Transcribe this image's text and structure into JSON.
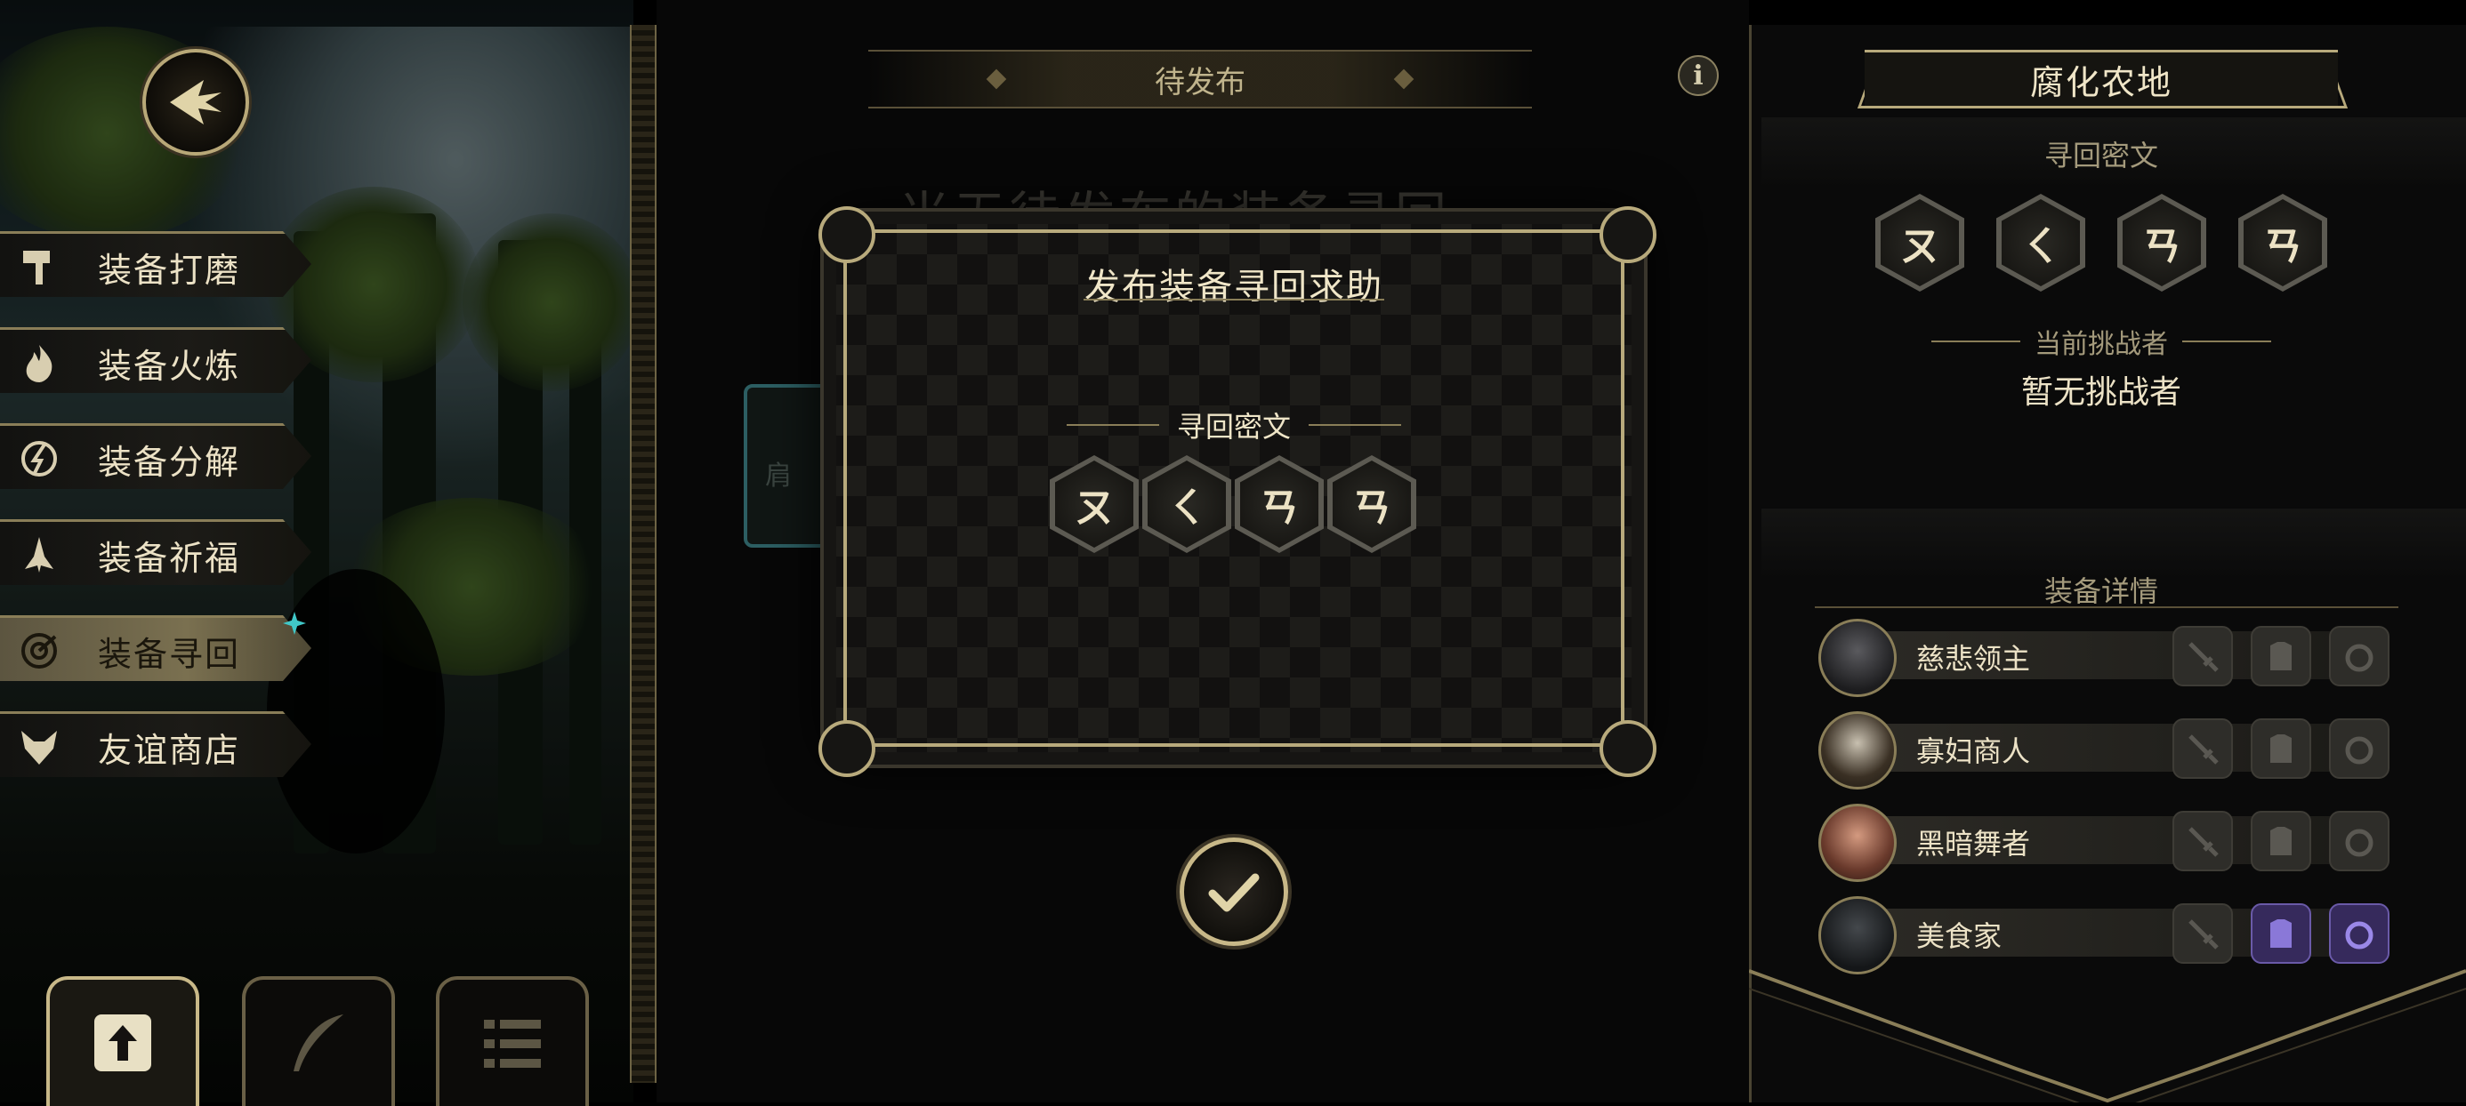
{
  "left_menu": {
    "items": [
      {
        "label": "装备打磨",
        "icon": "hammer-icon"
      },
      {
        "label": "装备火炼",
        "icon": "flame-icon"
      },
      {
        "label": "装备分解",
        "icon": "decompose-icon"
      },
      {
        "label": "装备祈福",
        "icon": "pray-hands-icon"
      },
      {
        "label": "装备寻回",
        "icon": "target-icon",
        "active": true
      },
      {
        "label": "友谊商店",
        "icon": "fox-icon"
      }
    ]
  },
  "bottom_tabs": [
    {
      "icon": "upload-document-icon",
      "selected": true
    },
    {
      "icon": "feather-icon"
    },
    {
      "icon": "list-icon"
    }
  ],
  "center": {
    "header": "待发布",
    "background_title": "当无待发布的装备寻回",
    "background_card_text": "肩"
  },
  "dialog": {
    "title": "发布装备寻回求助",
    "section_label": "寻回密文",
    "runes": [
      "ㄡ",
      "ㄑ",
      "ㄢ",
      "ㄢ"
    ]
  },
  "right_panel": {
    "location_title": "腐化农地",
    "cipher_label": "寻回密文",
    "runes": [
      "ㄡ",
      "ㄑ",
      "ㄢ",
      "ㄢ"
    ],
    "challenger_label": "当前挑战者",
    "challenger_value": "暂无挑战者",
    "equipment_label": "装备详情",
    "characters": [
      {
        "name": "慈悲领主",
        "slots": [
          false,
          false,
          false
        ]
      },
      {
        "name": "寡妇商人",
        "slots": [
          false,
          false,
          false
        ]
      },
      {
        "name": "黑暗舞者",
        "slots": [
          false,
          false,
          false
        ]
      },
      {
        "name": "美食家",
        "slots": [
          false,
          true,
          true
        ]
      }
    ]
  },
  "colors": {
    "gold_border": "#b8aa7c",
    "accent_teal": "#40c8c8",
    "owned_slot": "#362a5c"
  }
}
